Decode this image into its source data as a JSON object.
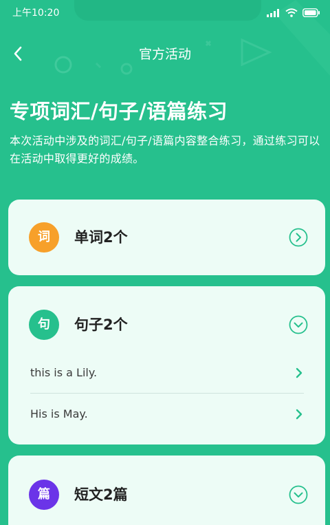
{
  "status_bar": {
    "time": "上午10:20"
  },
  "nav": {
    "back_icon": "chevron-left-icon",
    "title": "官方活动"
  },
  "header": {
    "title": "专项词汇/句子/语篇练习",
    "description": "本次活动中涉及的词汇/句子/语篇内容整合练习，通过练习可以在活动中取得更好的成绩。"
  },
  "sections": [
    {
      "badge": "词",
      "label": "单词2个",
      "badge_color": "#f7a02a",
      "state_icon": "chevron-right-circle-icon",
      "items": []
    },
    {
      "badge": "句",
      "label": "句子2个",
      "badge_color": "#26c08d",
      "state_icon": "chevron-down-circle-icon",
      "items": [
        {
          "text": "this is a Lily."
        },
        {
          "text": "His is May."
        }
      ]
    },
    {
      "badge": "篇",
      "label": "短文2篇",
      "badge_color": "#6b34e8",
      "state_icon": "chevron-down-circle-icon",
      "items": []
    }
  ],
  "colors": {
    "background": "#26c08d",
    "card": "#edfcf6",
    "accent": "#26c08d"
  }
}
